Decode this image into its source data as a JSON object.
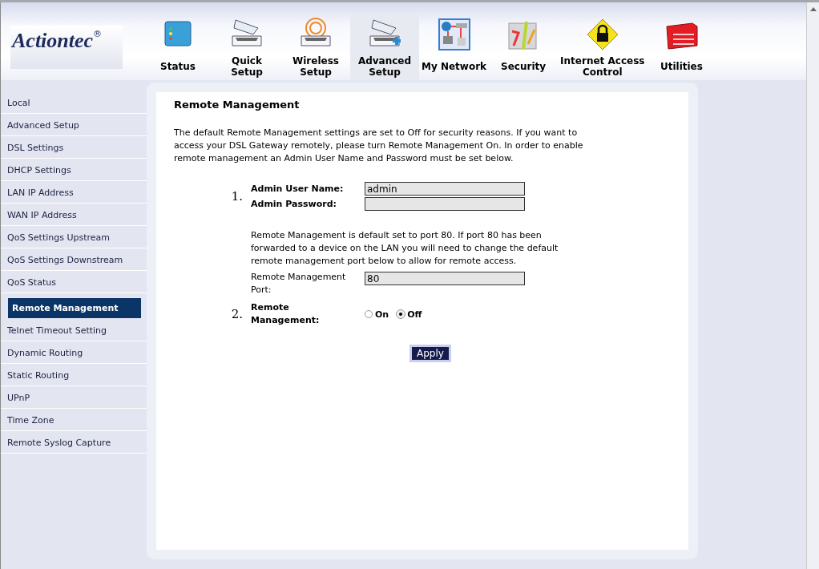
{
  "logo": {
    "text": "Actiontec",
    "mark": "®"
  },
  "nav": [
    {
      "label": "Status",
      "kind": "status",
      "selected": false
    },
    {
      "label": "Quick\nSetup",
      "kind": "scanner",
      "selected": false
    },
    {
      "label": "Wireless\nSetup",
      "kind": "wireless",
      "selected": false
    },
    {
      "label": "Advanced\nSetup",
      "kind": "advanced",
      "selected": true
    },
    {
      "label": "My Network",
      "kind": "network",
      "selected": false
    },
    {
      "label": "Security",
      "kind": "security",
      "selected": false
    },
    {
      "label": "Internet Access\nControl",
      "kind": "lock",
      "selected": false
    },
    {
      "label": "Utilities",
      "kind": "toolbox",
      "selected": false
    }
  ],
  "sidebar": {
    "items": [
      {
        "label": "Local",
        "selected": false
      },
      {
        "label": "Advanced Setup",
        "selected": false
      },
      {
        "label": "DSL Settings",
        "selected": false
      },
      {
        "label": "DHCP Settings",
        "selected": false
      },
      {
        "label": "LAN IP Address",
        "selected": false
      },
      {
        "label": "WAN IP Address",
        "selected": false
      },
      {
        "label": "QoS Settings Upstream",
        "selected": false
      },
      {
        "label": "QoS Settings Downstream",
        "selected": false
      },
      {
        "label": "QoS Status",
        "selected": false
      },
      {
        "label": "Remote Management",
        "selected": true
      },
      {
        "label": "Telnet Timeout Setting",
        "selected": false
      },
      {
        "label": "Dynamic Routing",
        "selected": false
      },
      {
        "label": "Static Routing",
        "selected": false
      },
      {
        "label": "UPnP",
        "selected": false
      },
      {
        "label": "Time Zone",
        "selected": false
      },
      {
        "label": "Remote Syslog Capture",
        "selected": false
      }
    ]
  },
  "content": {
    "title": "Remote Management",
    "intro": "The default Remote Management settings are set to Off for security reasons. If you want to access your DSL Gateway remotely, please turn Remote Management On. In order to enable remote management an Admin User Name and Password must be set below.",
    "step1": {
      "number": "1.",
      "user_label": "Admin User Name:",
      "user_value": "admin",
      "password_label": "Admin Password:"
    },
    "port_note": "Remote Management is default set to port 80. If port 80 has been forwarded to a device on the LAN you will need to change the default remote management port below to allow for remote access.",
    "port_label": "Remote Management Port:",
    "port_value": "80",
    "step2": {
      "number": "2.",
      "label": "Remote Management:",
      "options": [
        {
          "label": "On",
          "selected": false
        },
        {
          "label": "Off",
          "selected": true
        }
      ]
    },
    "apply": "Apply"
  }
}
